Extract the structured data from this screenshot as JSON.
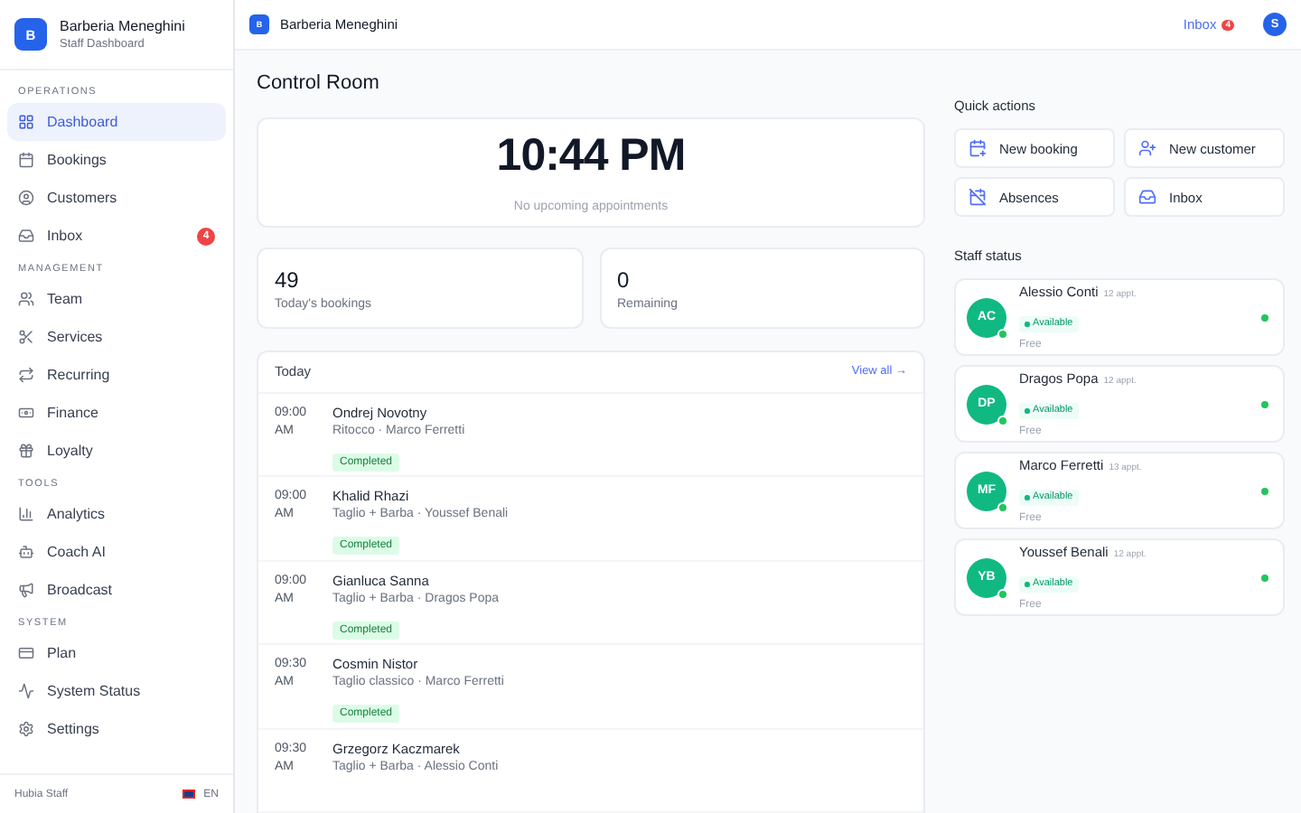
{
  "sidebar": {
    "brand": {
      "initial": "B",
      "name": "Barberia Meneghini",
      "subtitle": "Staff Dashboard"
    },
    "sections": [
      {
        "title": "OPERATIONS",
        "items": [
          {
            "label": "Dashboard",
            "selected": true
          },
          {
            "label": "Bookings",
            "selected": false
          },
          {
            "label": "Customers",
            "selected": false
          },
          {
            "label": "Inbox",
            "selected": false,
            "badge": "4"
          }
        ]
      },
      {
        "title": "MANAGEMENT",
        "items": [
          {
            "label": "Team",
            "selected": false
          },
          {
            "label": "Services",
            "selected": false
          },
          {
            "label": "Recurring",
            "selected": false
          },
          {
            "label": "Finance",
            "selected": false
          },
          {
            "label": "Loyalty",
            "selected": false
          }
        ]
      },
      {
        "title": "TOOLS",
        "items": [
          {
            "label": "Analytics",
            "selected": false
          },
          {
            "label": "Coach AI",
            "selected": false
          },
          {
            "label": "Broadcast",
            "selected": false
          }
        ]
      },
      {
        "title": "SYSTEM",
        "items": [
          {
            "label": "Plan",
            "selected": false
          },
          {
            "label": "System Status",
            "selected": false
          },
          {
            "label": "Settings",
            "selected": false
          }
        ]
      }
    ],
    "footer": {
      "label": "Hubia Staff",
      "language": "EN"
    }
  },
  "topbar": {
    "initial": "B",
    "name": "Barberia Meneghini",
    "inbox": "Inbox",
    "inbox_badge": "4",
    "avatar": "S"
  },
  "page_title": "Control Room",
  "clock": {
    "time": "10:44 PM",
    "note": "No upcoming appointments"
  },
  "stats": [
    {
      "value": "49",
      "label": "Today's bookings"
    },
    {
      "value": "0",
      "label": "Remaining"
    }
  ],
  "today": {
    "title": "Today",
    "link": "View all →",
    "rows": [
      {
        "time": "09:00\nAM",
        "name": "Ondrej Novotny",
        "detail": "Ritocco · Marco Ferretti",
        "status": "Completed"
      },
      {
        "time": "09:00\nAM",
        "name": "Khalid Rhazi",
        "detail": "Taglio + Barba · Youssef Benali",
        "status": "Completed"
      },
      {
        "time": "09:00\nAM",
        "name": "Gianluca Sanna",
        "detail": "Taglio + Barba · Dragos Popa",
        "status": "Completed"
      },
      {
        "time": "09:30\nAM",
        "name": "Cosmin Nistor",
        "detail": "Taglio classico · Marco Ferretti",
        "status": "Completed"
      },
      {
        "time": "09:30\nAM",
        "name": "Grzegorz Kaczmarek",
        "detail": "Taglio + Barba · Alessio Conti"
      }
    ]
  },
  "quick_actions": {
    "title": "Quick actions",
    "items": [
      "New booking",
      "New customer",
      "Absences",
      "Inbox"
    ]
  },
  "staff_status": {
    "title": "Staff status",
    "members": [
      {
        "initials": "AC",
        "name": "Alessio Conti",
        "appointments": "12 appt.",
        "status": "Available",
        "note": "Free",
        "online": true
      },
      {
        "initials": "DP",
        "name": "Dragos Popa",
        "appointments": "12 appt.",
        "status": "Available",
        "note": "Free",
        "online": true
      },
      {
        "initials": "MF",
        "name": "Marco Ferretti",
        "appointments": "13 appt.",
        "status": "Available",
        "note": "Free",
        "online": true
      },
      {
        "initials": "YB",
        "name": "Youssef Benali",
        "appointments": "12 appt.",
        "status": "Available",
        "note": "Free",
        "online": true
      }
    ]
  }
}
